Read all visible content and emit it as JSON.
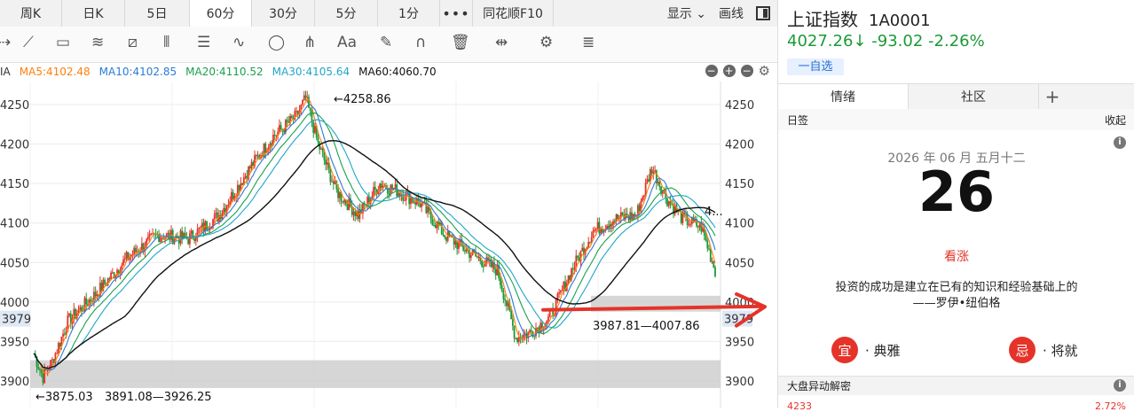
{
  "tabs": [
    "周K",
    "日K",
    "5日",
    "60分",
    "30分",
    "5分",
    "1分"
  ],
  "active_tab": "60分",
  "more_label": "•••",
  "f10_label": "同花顺F10",
  "display_label": "显示",
  "draw_label": "画线",
  "ma_labels": [
    {
      "text": "MA5:4102.48",
      "color": "#ff7f0e"
    },
    {
      "text": "MA10:4102.85",
      "color": "#2b7bd6"
    },
    {
      "text": "MA20:4110.52",
      "color": "#19a14c"
    },
    {
      "text": "MA30:4105.64",
      "color": "#21a5c9"
    },
    {
      "text": "MA60:4060.70",
      "color": "#111111"
    }
  ],
  "ma_prefix": "IA",
  "y_ticks": [
    4250,
    4200,
    4150,
    4100,
    4050,
    4000,
    3950,
    3900
  ],
  "y_left_extra": "3979",
  "y_right_extra": "3979",
  "chart_annotations": {
    "high": "←4258.86",
    "low": "←3875.03",
    "zone_low": "3891.08—3926.25",
    "zone_mid": "3987.81—4007.86",
    "ma_end": "4..."
  },
  "colors": {
    "up": "#e5332a",
    "down": "#1a9a37",
    "ma5": "#ff7f0e",
    "ma10": "#2b7bd6",
    "ma20": "#19a14c",
    "ma30": "#21a5c9",
    "ma60": "#111111"
  },
  "stock": {
    "name": "上证指数",
    "code": "1A0001",
    "price": "4027.26↓",
    "change": "-93.02",
    "pct": "-2.26%",
    "watch": "一自选"
  },
  "right_tabs": [
    "情绪",
    "社区"
  ],
  "right_add": "+",
  "calendar": {
    "section": "日签",
    "collapse": "收起",
    "date": "2026 年 06 月  五月十二",
    "day": "26",
    "trend": "看涨",
    "quote1": "投资的成功是建立在已有的知识和经验基础上的",
    "quote2": "——罗伊•纽伯格",
    "yi": "宜",
    "yi_text": "· 典雅",
    "ji": "忌",
    "ji_text": "· 将就"
  },
  "bottom": {
    "title": "大盘异动解密",
    "left_val": "4233",
    "right_val": "2.72%"
  }
}
